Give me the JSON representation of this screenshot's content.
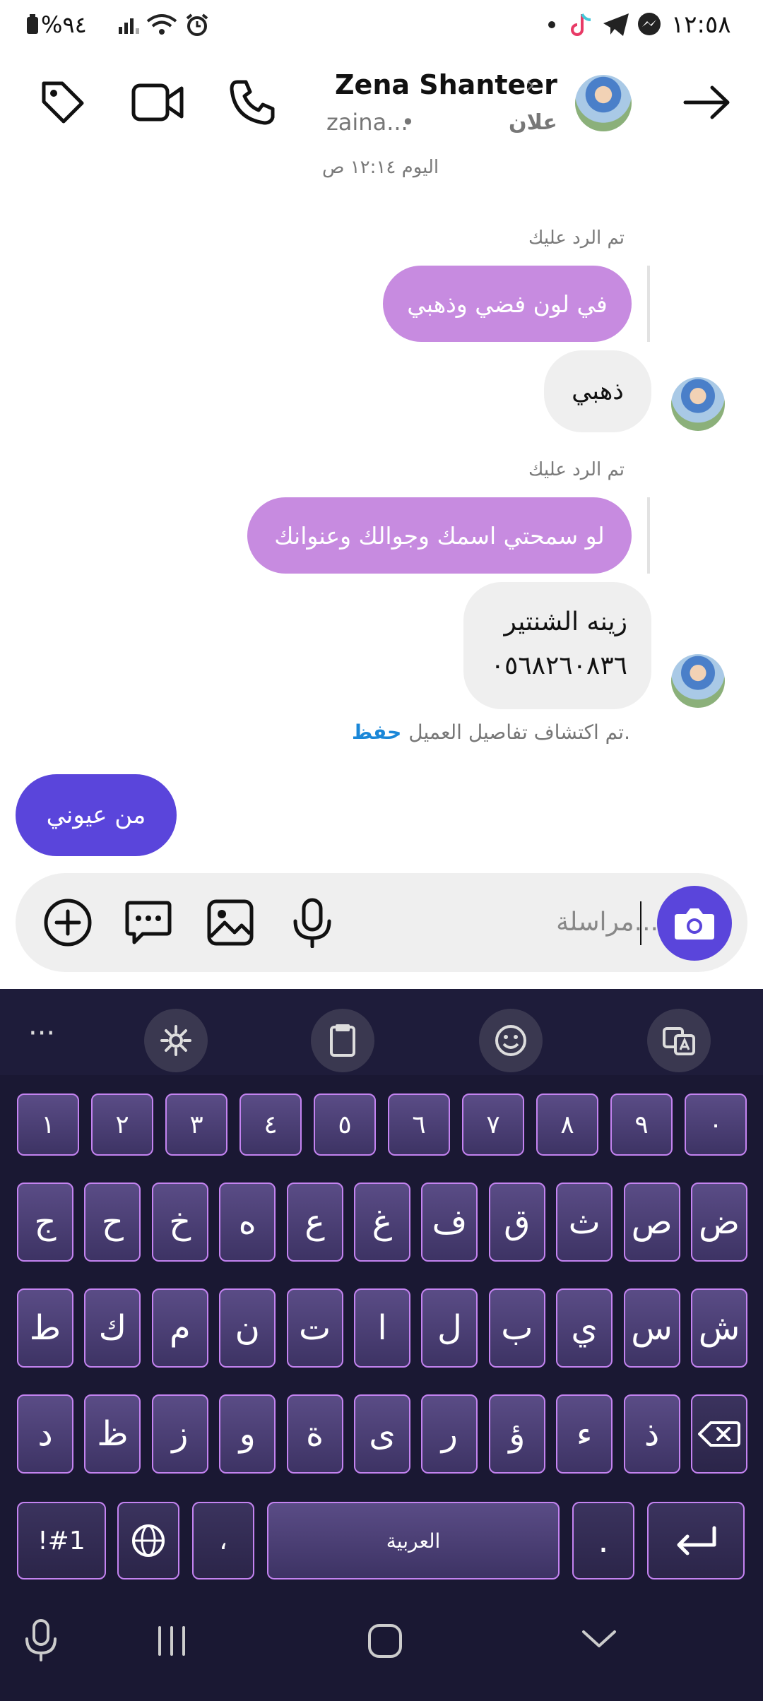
{
  "status_bar": {
    "time": "١٢:٥٨",
    "battery": "%٩٤"
  },
  "header": {
    "contact_name": "Zena Shanteer",
    "username": "zaina...",
    "ad_tag": "علان"
  },
  "chat": {
    "timestamp": "اليوم ١٢:١٤ ص",
    "reply_label": "تم الرد عليك",
    "msg_out_1": "في لون فضي وذهبي",
    "msg_in_1": "ذهبي",
    "msg_out_2": "لو سمحتي اسمك وجوالك وعنوانك",
    "msg_in_2_line1": "زينه الشنتير",
    "msg_in_2_line2": "٠٥٦٨٢٦٠٨٣٦",
    "detect_text": "تم اكتشاف تفاصيل العميل.",
    "save_link": "حفظ",
    "sent_msg": "من عيوني"
  },
  "composer": {
    "placeholder": "مراسلة..."
  },
  "keyboard": {
    "numbers": [
      "١",
      "٢",
      "٣",
      "٤",
      "٥",
      "٦",
      "٧",
      "٨",
      "٩",
      "٠"
    ],
    "row1": [
      "ض",
      "ص",
      "ث",
      "ق",
      "ف",
      "غ",
      "ع",
      "ه",
      "خ",
      "ح",
      "ج"
    ],
    "row2": [
      "ش",
      "س",
      "ي",
      "ب",
      "ل",
      "ا",
      "ت",
      "ن",
      "م",
      "ك",
      "ط"
    ],
    "row3": [
      "ذ",
      "ء",
      "ؤ",
      "ر",
      "ى",
      "ة",
      "و",
      "ز",
      "ظ",
      "د"
    ],
    "symbols_key": "!#1",
    "comma_key": "،",
    "space_label": "العربية",
    "period_key": "."
  }
}
